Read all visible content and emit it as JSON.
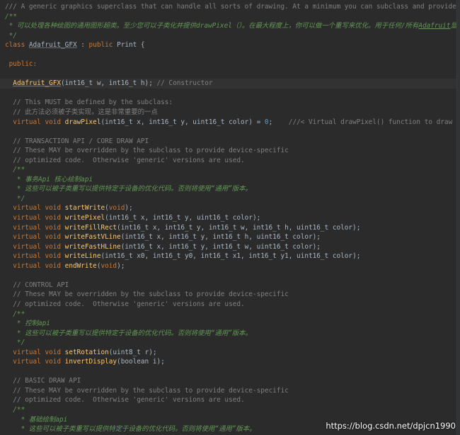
{
  "watermark": "https://blog.csdn.net/dpjcn1990",
  "lines": [
    [
      {
        "t": "/// A generic graphics superclass that can handle all sorts of drawing. At a minimum you can subclass and provide drawPixel(). At a maxim",
        "c": "comment"
      }
    ],
    [
      {
        "t": "/**",
        "c": "doc"
      }
    ],
    [
      {
        "t": " * 可以处理各种绘图的通用图形超类。至少您可以子类化并提供drawPixel（）。在最大程度上，你可以做一个重写来优化。用于任何/所有",
        "c": "doc"
      },
      {
        "t": "Adafruit",
        "c": "link"
      },
      {
        "t": "显示器！",
        "c": "doc"
      }
    ],
    [
      {
        "t": " */",
        "c": "doc"
      }
    ],
    [
      {
        "t": "class ",
        "c": "kw"
      },
      {
        "t": "Adafruit_GFX",
        "c": "class"
      },
      {
        "t": " : ",
        "c": "plain"
      },
      {
        "t": "public ",
        "c": "kw"
      },
      {
        "t": "Print {",
        "c": "plain"
      }
    ],
    [],
    [
      {
        "t": " public:",
        "c": "kw"
      }
    ],
    [],
    [
      {
        "t": "  ",
        "c": "plain"
      },
      {
        "t": "Adafruit_GFX",
        "c": "ctor"
      },
      {
        "t": "(int16_t w, int16_t h); ",
        "c": "plain"
      },
      {
        "t": "// Constructor",
        "c": "comment"
      }
    ],
    [],
    [
      {
        "t": "  // This MUST be defined by the subclass:",
        "c": "comment"
      }
    ],
    [
      {
        "t": "  // 此方法必须被子类实现，这是非常重要的一点",
        "c": "comment"
      }
    ],
    [
      {
        "t": "  ",
        "c": "plain"
      },
      {
        "t": "virtual void ",
        "c": "kw"
      },
      {
        "t": "drawPixel",
        "c": "fn"
      },
      {
        "t": "(int16_t x, int16_t y, uint16_t color) = ",
        "c": "plain"
      },
      {
        "t": "0",
        "c": "num"
      },
      {
        "t": ";    ",
        "c": "plain"
      },
      {
        "t": "///< Virtual drawPixel() function to draw to the screen/framebuffe",
        "c": "comment"
      }
    ],
    [],
    [
      {
        "t": "  // TRANSACTION API / CORE DRAW API",
        "c": "comment"
      }
    ],
    [
      {
        "t": "  // These MAY be overridden by the subclass to provide device-specific",
        "c": "comment"
      }
    ],
    [
      {
        "t": "  // optimized code.  Otherwise 'generic' versions are used.",
        "c": "comment"
      }
    ],
    [
      {
        "t": "  /**",
        "c": "doc"
      }
    ],
    [
      {
        "t": "   * 事务Api 核心绘制api",
        "c": "doc"
      }
    ],
    [
      {
        "t": "   * 这些可以被子类重写以提供特定于设备的优化代码。否则将使用“通用”版本。",
        "c": "doc"
      }
    ],
    [
      {
        "t": "   */",
        "c": "doc"
      }
    ],
    [
      {
        "t": "  ",
        "c": "plain"
      },
      {
        "t": "virtual void ",
        "c": "kw"
      },
      {
        "t": "startWrite",
        "c": "fn"
      },
      {
        "t": "(",
        "c": "plain"
      },
      {
        "t": "void",
        "c": "kw"
      },
      {
        "t": ");",
        "c": "plain"
      }
    ],
    [
      {
        "t": "  ",
        "c": "plain"
      },
      {
        "t": "virtual void ",
        "c": "kw"
      },
      {
        "t": "writePixel",
        "c": "fn"
      },
      {
        "t": "(int16_t x, int16_t y, uint16_t color);",
        "c": "plain"
      }
    ],
    [
      {
        "t": "  ",
        "c": "plain"
      },
      {
        "t": "virtual void ",
        "c": "kw"
      },
      {
        "t": "writeFillRect",
        "c": "fn"
      },
      {
        "t": "(int16_t x, int16_t y, int16_t w, int16_t h, uint16_t color);",
        "c": "plain"
      }
    ],
    [
      {
        "t": "  ",
        "c": "plain"
      },
      {
        "t": "virtual void ",
        "c": "kw"
      },
      {
        "t": "writeFastVLine",
        "c": "fn"
      },
      {
        "t": "(int16_t x, int16_t y, int16_t h, uint16_t color);",
        "c": "plain"
      }
    ],
    [
      {
        "t": "  ",
        "c": "plain"
      },
      {
        "t": "virtual void ",
        "c": "kw"
      },
      {
        "t": "writeFastHLine",
        "c": "fn"
      },
      {
        "t": "(int16_t x, int16_t y, int16_t w, uint16_t color);",
        "c": "plain"
      }
    ],
    [
      {
        "t": "  ",
        "c": "plain"
      },
      {
        "t": "virtual void ",
        "c": "kw"
      },
      {
        "t": "writeLine",
        "c": "fn"
      },
      {
        "t": "(int16_t x0, int16_t y0, int16_t x1, int16_t y1, uint16_t color);",
        "c": "plain"
      }
    ],
    [
      {
        "t": "  ",
        "c": "plain"
      },
      {
        "t": "virtual void ",
        "c": "kw"
      },
      {
        "t": "endWrite",
        "c": "fn"
      },
      {
        "t": "(",
        "c": "plain"
      },
      {
        "t": "void",
        "c": "kw"
      },
      {
        "t": ");",
        "c": "plain"
      }
    ],
    [],
    [
      {
        "t": "  // CONTROL API",
        "c": "comment"
      }
    ],
    [
      {
        "t": "  // These MAY be overridden by the subclass to provide device-specific",
        "c": "comment"
      }
    ],
    [
      {
        "t": "  // optimized code.  Otherwise 'generic' versions are used.",
        "c": "comment"
      }
    ],
    [
      {
        "t": "  /**",
        "c": "doc"
      }
    ],
    [
      {
        "t": "   * 控制api",
        "c": "doc"
      }
    ],
    [
      {
        "t": "   * 这些可以被子类重写以提供特定于设备的优化代码。否则将使用“通用”版本。",
        "c": "doc"
      }
    ],
    [
      {
        "t": "   */",
        "c": "doc"
      }
    ],
    [
      {
        "t": "  ",
        "c": "plain"
      },
      {
        "t": "virtual void ",
        "c": "kw"
      },
      {
        "t": "setRotation",
        "c": "fn"
      },
      {
        "t": "(uint8_t r);",
        "c": "plain"
      }
    ],
    [
      {
        "t": "  ",
        "c": "plain"
      },
      {
        "t": "virtual void ",
        "c": "kw"
      },
      {
        "t": "invertDisplay",
        "c": "fn"
      },
      {
        "t": "(boolean i);",
        "c": "plain"
      }
    ],
    [],
    [
      {
        "t": "  // BASIC DRAW API",
        "c": "comment"
      }
    ],
    [
      {
        "t": "  // These MAY be overridden by the subclass to provide device-specific",
        "c": "comment"
      }
    ],
    [
      {
        "t": "  // optimized code.  Otherwise 'generic' versions are used.",
        "c": "comment"
      }
    ],
    [
      {
        "t": "  /**",
        "c": "doc"
      }
    ],
    [
      {
        "t": "    * 基础绘制api",
        "c": "doc"
      }
    ],
    [
      {
        "t": "    * 这些可以被子类重写以提供特定于设备的优化代码。否则将使用“通用”版本。",
        "c": "doc"
      }
    ]
  ]
}
